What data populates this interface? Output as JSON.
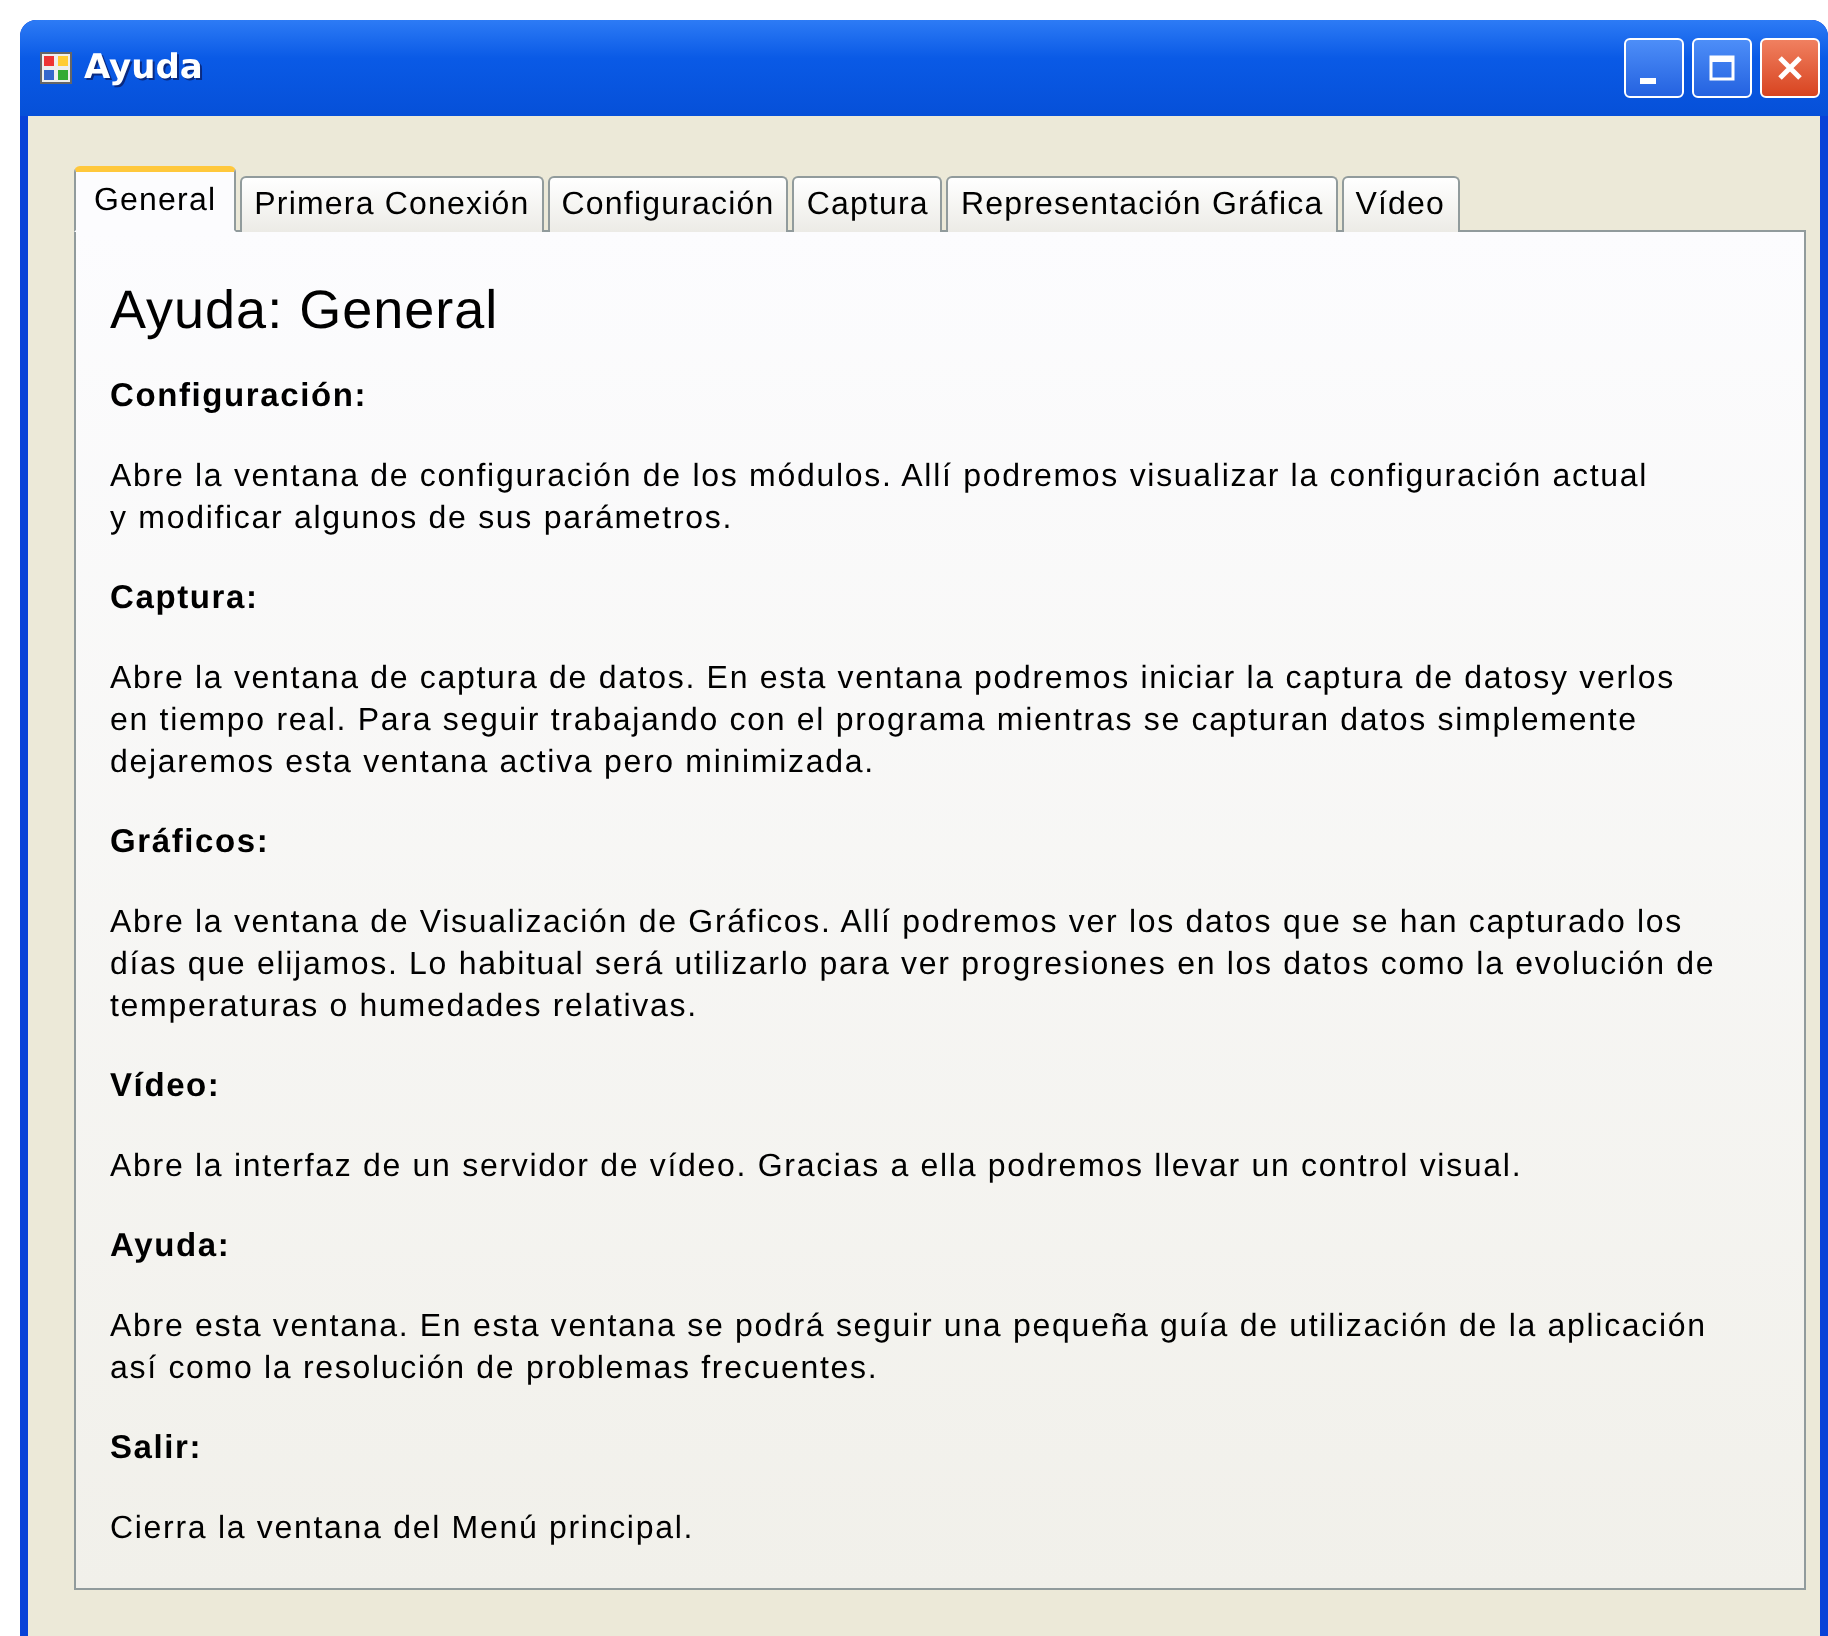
{
  "window": {
    "title": "Ayuda"
  },
  "tabs": [
    {
      "label": "General",
      "selected": true
    },
    {
      "label": "Primera Conexión",
      "selected": false
    },
    {
      "label": "Configuración",
      "selected": false
    },
    {
      "label": "Captura",
      "selected": false
    },
    {
      "label": "Representación Gráfica",
      "selected": false
    },
    {
      "label": "Vídeo",
      "selected": false
    }
  ],
  "page": {
    "heading": "Ayuda: General",
    "sections": [
      {
        "title": "Configuración:",
        "text": "Abre la ventana de configuración de los módulos. Allí podremos visualizar la configuración actual\ny modificar algunos de sus parámetros."
      },
      {
        "title": "Captura:",
        "text": "Abre la ventana de captura de datos. En esta ventana podremos iniciar la captura de datosy verlos\nen tiempo real. Para seguir trabajando con el programa mientras se capturan datos simplemente\ndejaremos esta ventana activa pero minimizada."
      },
      {
        "title": "Gráficos:",
        "text": "Abre la ventana de Visualización de Gráficos. Allí podremos ver los datos que se han capturado los\ndías que elijamos. Lo habitual será utilizarlo para ver progresiones en los datos como la evolución de\ntemperaturas o humedades relativas."
      },
      {
        "title": "Vídeo:",
        "text": "Abre la interfaz de un servidor de vídeo. Gracias a ella podremos llevar un control visual."
      },
      {
        "title": "Ayuda:",
        "text": "Abre esta ventana. En esta ventana se podrá seguir una pequeña guía de utilización de la aplicación\nasí como la resolución de problemas frecuentes."
      },
      {
        "title": "Salir:",
        "text": "Cierra la ventana del Menú principal."
      }
    ]
  }
}
